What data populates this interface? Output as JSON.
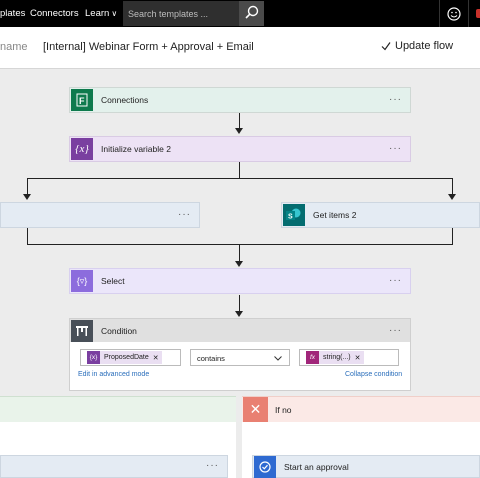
{
  "topnav": {
    "templates": "plates",
    "connectors": "Connectors",
    "learn": "Learn",
    "search_placeholder": "Search templates ..."
  },
  "header": {
    "flow_name_label": "name",
    "title": "[Internal] Webinar Form + Approval + Email",
    "update_label": "Update flow"
  },
  "steps": {
    "connections": {
      "label": "Connections",
      "icon": "forms-icon",
      "color": "#0e7a4d"
    },
    "init_var": {
      "label": "Initialize variable 2",
      "icon": "variable-icon",
      "color": "#7a3fa0"
    },
    "left_branch": {
      "label": ""
    },
    "get_items": {
      "label": "Get items 2",
      "icon": "sharepoint-icon",
      "color": "#036c70"
    },
    "select": {
      "label": "Select",
      "icon": "select-icon",
      "color": "#8c6cdd"
    },
    "condition": {
      "label": "Condition",
      "left_value": "ProposedDate",
      "operator": "contains",
      "right_value": "string(...)",
      "edit_advanced": "Edit in advanced mode",
      "collapse": "Collapse condition"
    }
  },
  "branches": {
    "if_no": "If no",
    "approval_label": "Start an approval"
  },
  "more_glyph": "···",
  "colors": {
    "connections_bg": "#e3f1ec",
    "variable_bg": "#ede2f5",
    "select_bg": "#ebe6fa",
    "sharepoint_bg": "#e4ebf3",
    "condition_header_bg": "#e0e0e0"
  }
}
